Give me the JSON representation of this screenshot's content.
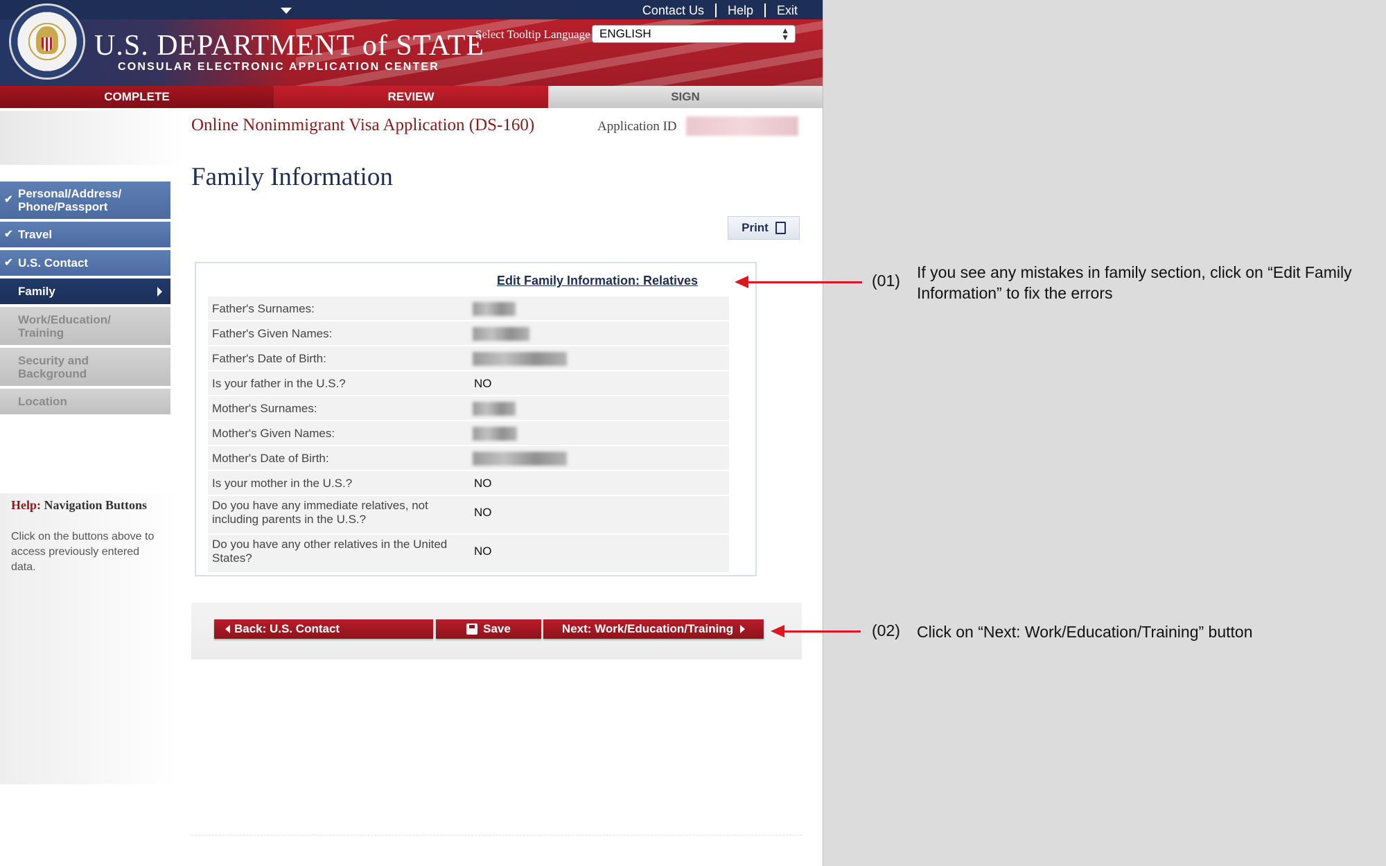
{
  "header": {
    "top_links": [
      "Contact Us",
      "Help",
      "Exit"
    ],
    "title": "U.S. DEPARTMENT of STATE",
    "subtitle": "CONSULAR ELECTRONIC APPLICATION CENTER",
    "tooltip_label": "Select Tooltip Language",
    "language": "ENGLISH"
  },
  "tabs": [
    {
      "label": "COMPLETE"
    },
    {
      "label": "REVIEW"
    },
    {
      "label": "SIGN"
    }
  ],
  "form": {
    "title": "Online Nonimmigrant Visa Application (DS-160)",
    "app_id_label": "Application ID"
  },
  "page": {
    "title": "Family Information",
    "print_label": "Print"
  },
  "sidebar": {
    "items": [
      {
        "label": "Personal/Address/ Phone/Passport",
        "state": "done"
      },
      {
        "label": "Travel",
        "state": "done"
      },
      {
        "label": "U.S. Contact",
        "state": "done"
      },
      {
        "label": "Family",
        "state": "active"
      },
      {
        "label": "Work/Education/ Training",
        "state": "todo"
      },
      {
        "label": "Security and Background",
        "state": "todo"
      },
      {
        "label": "Location",
        "state": "todo"
      }
    ],
    "help_label": "Help:",
    "help_title": "Navigation Buttons",
    "help_text": "Click on the buttons above to access previously entered data."
  },
  "review": {
    "edit_link": "Edit Family Information: Relatives",
    "fields": [
      {
        "label": "Father's Surnames:",
        "value": ""
      },
      {
        "label": "Father's Given Names:",
        "value": ""
      },
      {
        "label": "Father's Date of Birth:",
        "value": ""
      },
      {
        "label": "Is your father in the U.S.?",
        "value": "NO"
      },
      {
        "label": "Mother's Surnames:",
        "value": ""
      },
      {
        "label": "Mother's Given Names:",
        "value": ""
      },
      {
        "label": "Mother's Date of Birth:",
        "value": ""
      },
      {
        "label": "Is your mother in the U.S.?",
        "value": "NO"
      },
      {
        "label": "Do you have any immediate relatives, not including parents in the U.S.?",
        "value": "NO"
      },
      {
        "label": "Do you have any other relatives in the United States?",
        "value": "NO"
      }
    ]
  },
  "actions": {
    "back": "Back: U.S. Contact",
    "save": "Save",
    "next": "Next: Work/Education/Training"
  },
  "annotations": [
    {
      "number": "(01)",
      "text": "If you see any mistakes in family section, click on “Edit Family Information” to fix the errors"
    },
    {
      "number": "(02)",
      "text": "Click on “Next: Work/Education/Training” button"
    }
  ]
}
